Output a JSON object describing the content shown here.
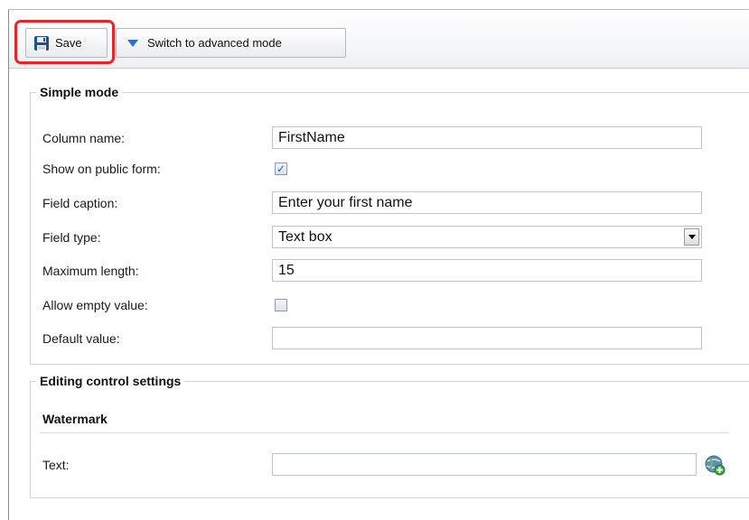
{
  "toolbar": {
    "save_label": "Save",
    "advanced_label": "Switch to advanced mode"
  },
  "simple_mode": {
    "legend": "Simple mode",
    "column_name": {
      "label": "Column name:",
      "value": "FirstName"
    },
    "show_on_public_form": {
      "label": "Show on public form:",
      "checked": true
    },
    "field_caption": {
      "label": "Field caption:",
      "value": "Enter your first name"
    },
    "field_type": {
      "label": "Field type:",
      "value": "Text box"
    },
    "maximum_length": {
      "label": "Maximum length:",
      "value": "15"
    },
    "allow_empty_value": {
      "label": "Allow empty value:",
      "checked": false
    },
    "default_value": {
      "label": "Default value:",
      "value": ""
    }
  },
  "editing_control": {
    "legend": "Editing control settings",
    "watermark": {
      "title": "Watermark",
      "text_label": "Text:",
      "text_value": ""
    }
  },
  "icons": {
    "save": "floppy-disk-icon",
    "advanced": "triangle-down-icon",
    "add": "globe-add-icon"
  },
  "colors": {
    "highlight": "#e0282c",
    "accent_blue": "#2b6ec8"
  }
}
